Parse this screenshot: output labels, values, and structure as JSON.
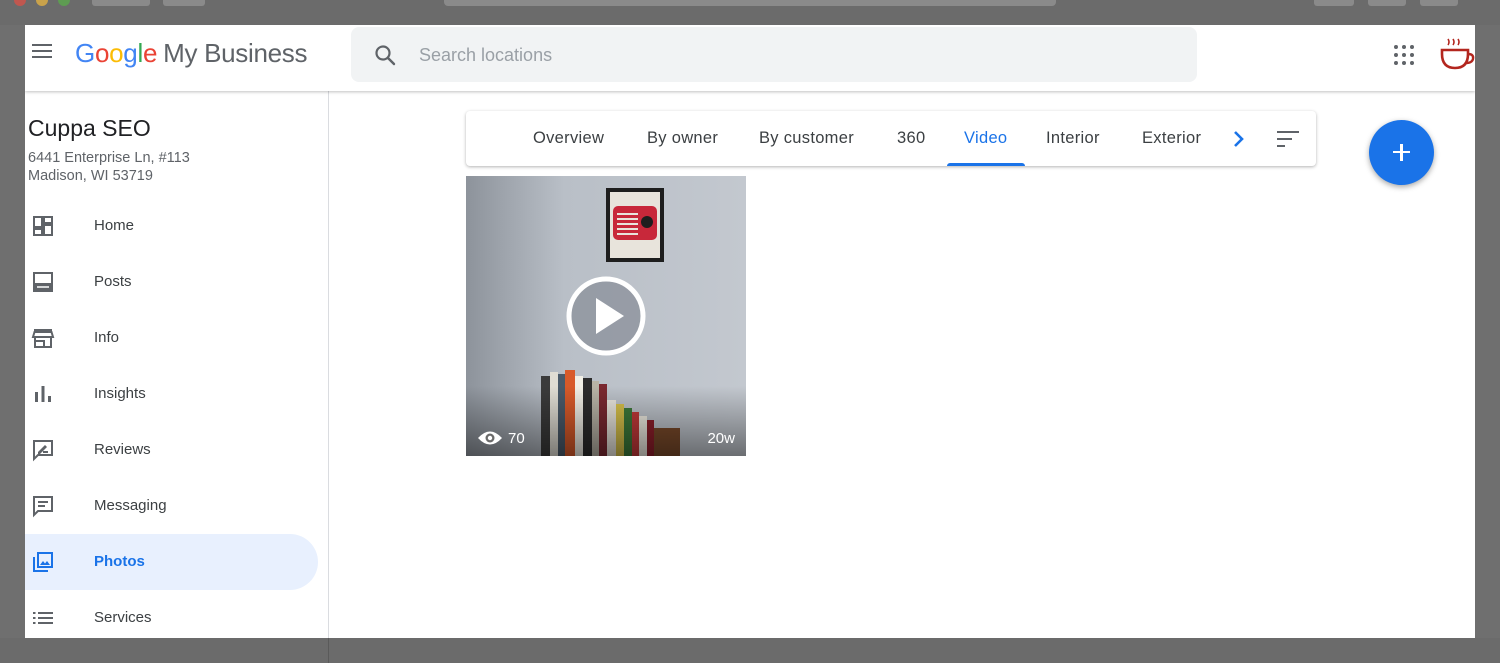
{
  "header": {
    "logo_google": "Google",
    "logo_product": "My Business",
    "search_placeholder": "Search locations"
  },
  "business": {
    "name": "Cuppa SEO",
    "address_line1": "6441 Enterprise Ln, #113",
    "address_line2": "Madison, WI 53719"
  },
  "sidebar": {
    "items": [
      {
        "label": "Home",
        "icon": "dashboard-icon"
      },
      {
        "label": "Posts",
        "icon": "posts-icon"
      },
      {
        "label": "Info",
        "icon": "storefront-icon"
      },
      {
        "label": "Insights",
        "icon": "bar-chart-icon"
      },
      {
        "label": "Reviews",
        "icon": "rate-review-icon"
      },
      {
        "label": "Messaging",
        "icon": "chat-icon"
      },
      {
        "label": "Photos",
        "icon": "photo-library-icon",
        "active": true
      },
      {
        "label": "Services",
        "icon": "list-icon"
      }
    ]
  },
  "tabs": {
    "items": [
      {
        "label": "Overview"
      },
      {
        "label": "By owner"
      },
      {
        "label": "By customer"
      },
      {
        "label": "360"
      },
      {
        "label": "Video",
        "active": true
      },
      {
        "label": "Interior"
      },
      {
        "label": "Exterior"
      }
    ]
  },
  "media": {
    "video": {
      "views": "70",
      "age": "20w"
    }
  },
  "colors": {
    "accent": "#1a73e8",
    "active_bg": "#e8f0fe",
    "icon_grey": "#5f6368",
    "avatar_red": "#b3261e"
  }
}
